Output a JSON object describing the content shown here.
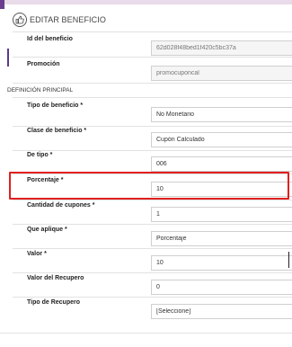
{
  "header": {
    "title": "EDITAR BENEFICIO",
    "icon": "thumbs-up-icon"
  },
  "fields_top": [
    {
      "key": "id",
      "label": "Id del beneficio",
      "value": "62d028f48bed1f420c5bc37a",
      "readonly": true
    },
    {
      "key": "promocion",
      "label": "Promoción",
      "value": "promocuponcal",
      "readonly": true
    }
  ],
  "section": {
    "title": "DEFINICIÓN PRINCIPAL"
  },
  "fields_main": [
    {
      "key": "tipo_beneficio",
      "label": "Tipo de beneficio *",
      "value": "No Monetario"
    },
    {
      "key": "clase_beneficio",
      "label": "Clase de beneficio *",
      "value": "Cupón Calculado"
    },
    {
      "key": "de_tipo",
      "label": "De tipo *",
      "value": "006"
    },
    {
      "key": "porcentaje",
      "label": "Porcentaje *",
      "value": "10"
    },
    {
      "key": "cantidad_cupones",
      "label": "Cantidad de cupones *",
      "value": "1"
    },
    {
      "key": "que_aplique",
      "label": "Que aplique *",
      "value": "Porcentaje"
    },
    {
      "key": "valor",
      "label": "Valor *",
      "value": "10"
    },
    {
      "key": "valor_recupero",
      "label": "Valor del Recupero",
      "value": "0"
    },
    {
      "key": "tipo_recupero",
      "label": "Tipo de Recupero",
      "value": "[Seleccione]"
    }
  ],
  "colors": {
    "highlight": "#e02020",
    "accent": "#6b3d8f"
  }
}
